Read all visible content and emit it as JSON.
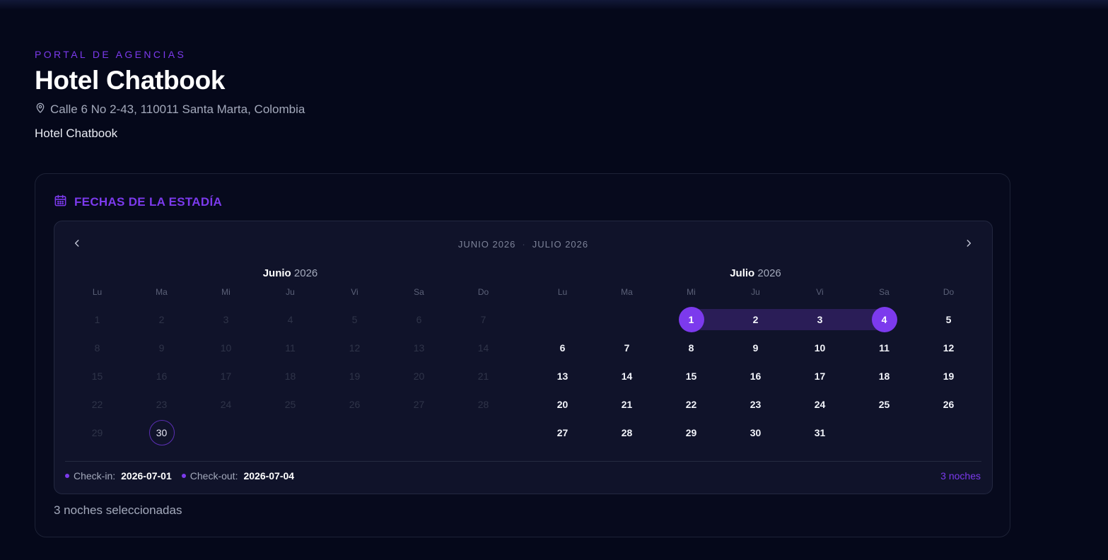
{
  "header": {
    "eyebrow": "PORTAL DE AGENCIAS",
    "title": "Hotel Chatbook",
    "address": "Calle 6 No 2-43, 110011 Santa Marta, Colombia",
    "subname": "Hotel Chatbook"
  },
  "card": {
    "title": "FECHAS DE LA ESTADÍA",
    "summary": "3 noches seleccionadas"
  },
  "calendar": {
    "range_left": "JUNIO 2026",
    "range_sep": "·",
    "range_right": "JULIO 2026",
    "months": [
      {
        "name": "Junio",
        "year": "2026",
        "weekdays": [
          "Lu",
          "Ma",
          "Mi",
          "Ju",
          "Vi",
          "Sa",
          "Do"
        ],
        "days": [
          "1",
          "2",
          "3",
          "4",
          "5",
          "6",
          "7",
          "8",
          "9",
          "10",
          "11",
          "12",
          "13",
          "14",
          "15",
          "16",
          "17",
          "18",
          "19",
          "20",
          "21",
          "22",
          "23",
          "24",
          "25",
          "26",
          "27",
          "28",
          "29",
          "30"
        ]
      },
      {
        "name": "Julio",
        "year": "2026",
        "weekdays": [
          "Lu",
          "Ma",
          "Mi",
          "Ju",
          "Vi",
          "Sa",
          "Do"
        ],
        "days": [
          "1",
          "2",
          "3",
          "4",
          "5",
          "6",
          "7",
          "8",
          "9",
          "10",
          "11",
          "12",
          "13",
          "14",
          "15",
          "16",
          "17",
          "18",
          "19",
          "20",
          "21",
          "22",
          "23",
          "24",
          "25",
          "26",
          "27",
          "28",
          "29",
          "30",
          "31"
        ]
      }
    ],
    "footer": {
      "checkin_label": "Check-in:",
      "checkin_value": "2026-07-01",
      "checkout_label": "Check-out:",
      "checkout_value": "2026-07-04",
      "nights": "3 noches"
    }
  },
  "colors": {
    "accent": "#7c3aed",
    "range": "#2a1d57",
    "background": "#05081a"
  },
  "icons": [
    "map-pin-icon",
    "calendar-icon",
    "chevron-left-icon",
    "chevron-right-icon"
  ]
}
